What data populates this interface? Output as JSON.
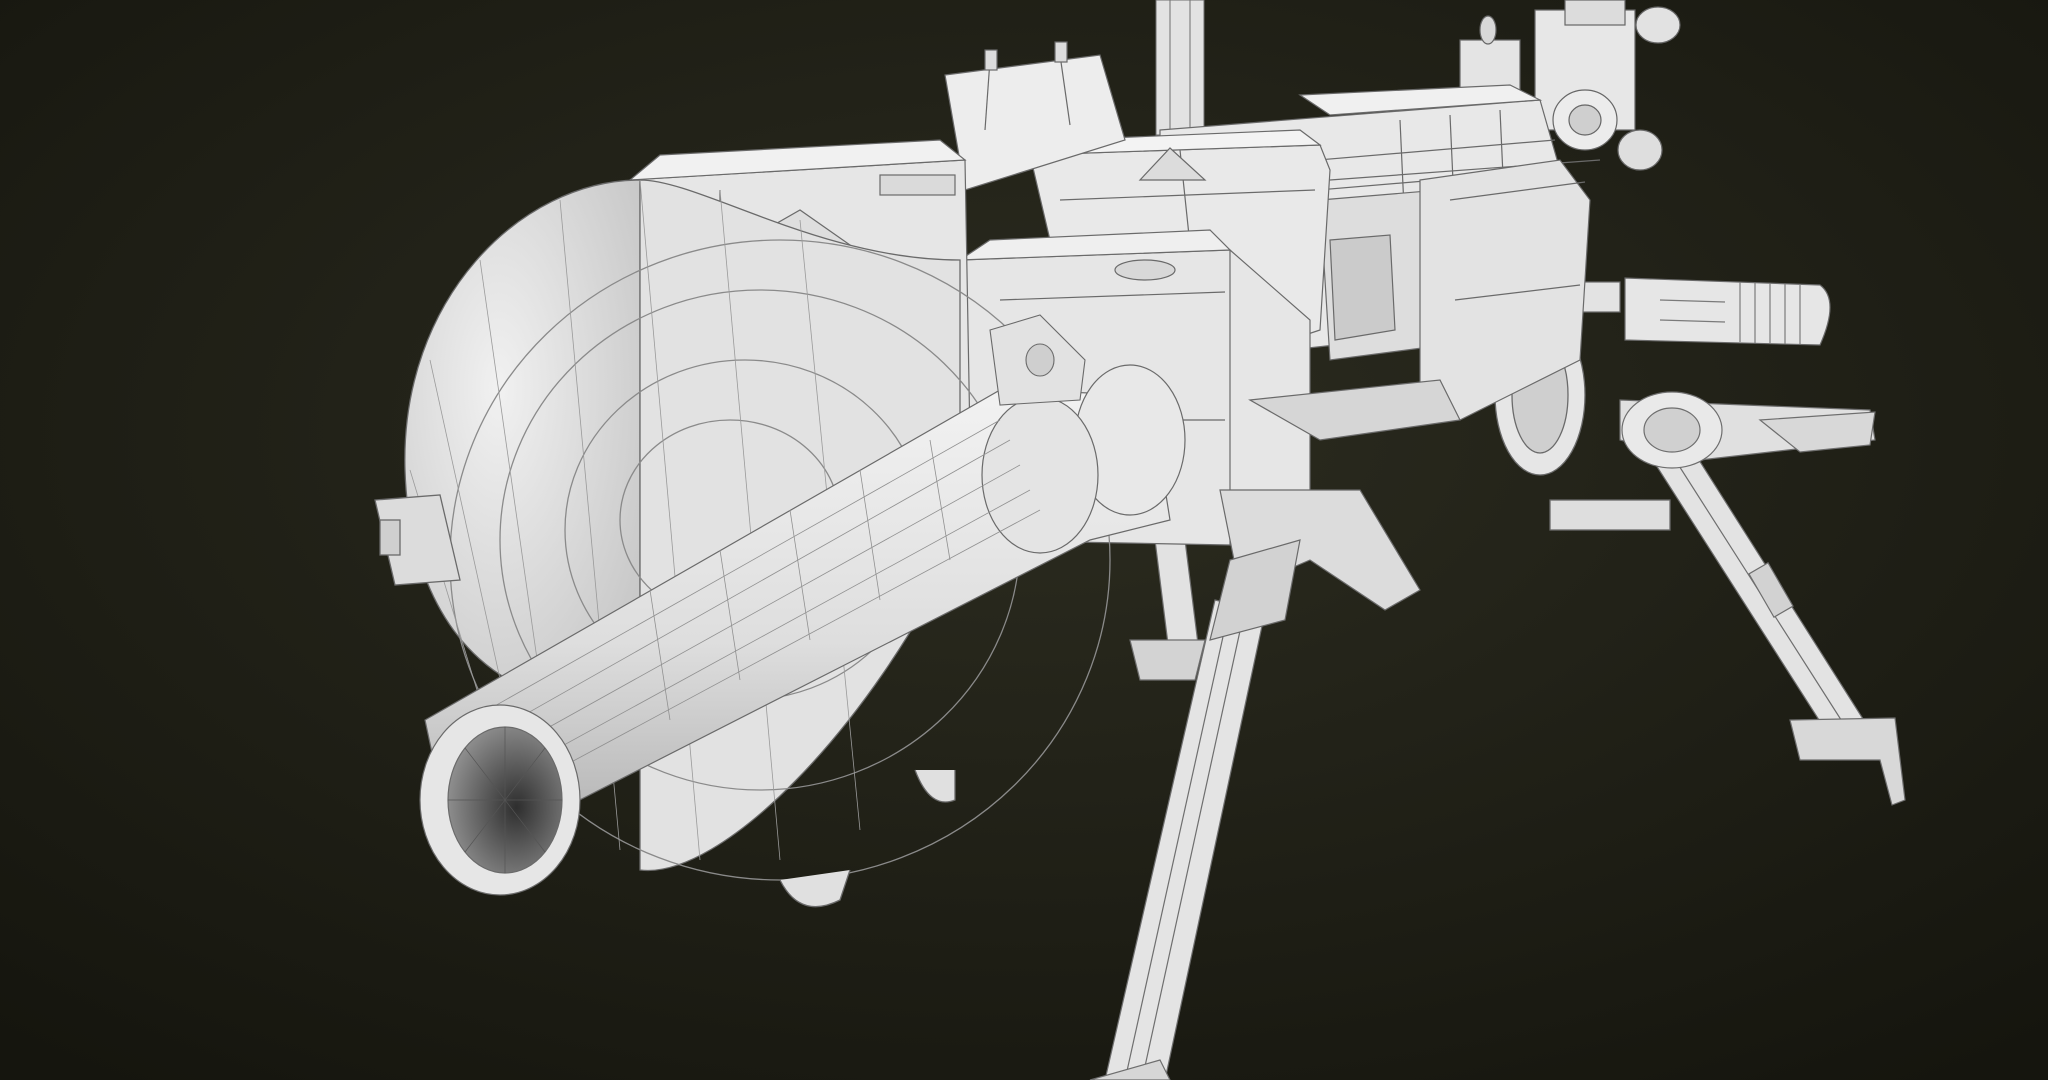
{
  "scene": {
    "subject": "wireframe-render",
    "colors": {
      "background_center": "#2a2a1e",
      "background_edge": "#16160f",
      "mesh_fill": "#e9e9e9",
      "mesh_shadow": "#bdbdbd",
      "wire": "#7a7a7a",
      "wire_dark": "#4a4a4a"
    }
  }
}
